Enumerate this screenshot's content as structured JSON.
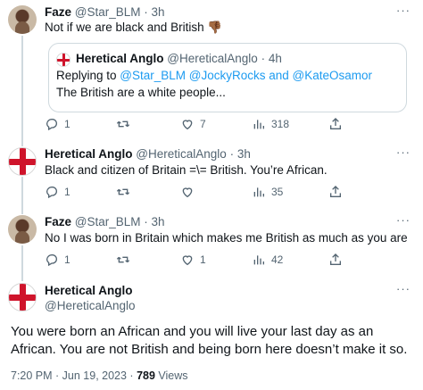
{
  "tweets": [
    {
      "name": "Faze",
      "handle": "@Star_BLM",
      "time": "· 3h",
      "text": "Not if we are black and British 👎🏾",
      "quote": {
        "name": "Heretical Anglo",
        "handle": "@HereticalAnglo",
        "time": "· 4h",
        "replying_prefix": "Replying to ",
        "replying_to": "@Star_BLM @JockyRocks and @KateOsamor",
        "text": "The British are a white people..."
      },
      "replies": "1",
      "retweets": "",
      "likes": "7",
      "views": "318"
    },
    {
      "name": "Heretical Anglo",
      "handle": "@HereticalAnglo",
      "time": "· 3h",
      "text": "Black and citizen of Britain =\\= British. You’re African.",
      "replies": "1",
      "retweets": "",
      "likes": "",
      "views": "35"
    },
    {
      "name": "Faze",
      "handle": "@Star_BLM",
      "time": "· 3h",
      "text": "No I was born in Britain which makes me British as much as you are",
      "replies": "1",
      "retweets": "",
      "likes": "1",
      "views": "42"
    }
  ],
  "main": {
    "name": "Heretical Anglo",
    "handle": "@HereticalAnglo",
    "text": "You were born an African and you will live your last day as an African. You are not British and being born here doesn’t make it so.",
    "time": "7:20 PM · Jun 19, 2023 · ",
    "views_count": "789",
    "views_label": " Views"
  },
  "icons": {
    "more": "more-icon",
    "reply": "reply-icon",
    "retweet": "retweet-icon",
    "like": "like-icon",
    "views": "views-icon",
    "share": "share-icon"
  },
  "colors": {
    "text": "#0f1419",
    "muted": "#536471",
    "link": "#1d9bf0",
    "border": "#cfd9de",
    "flag_red": "#cf142b"
  }
}
